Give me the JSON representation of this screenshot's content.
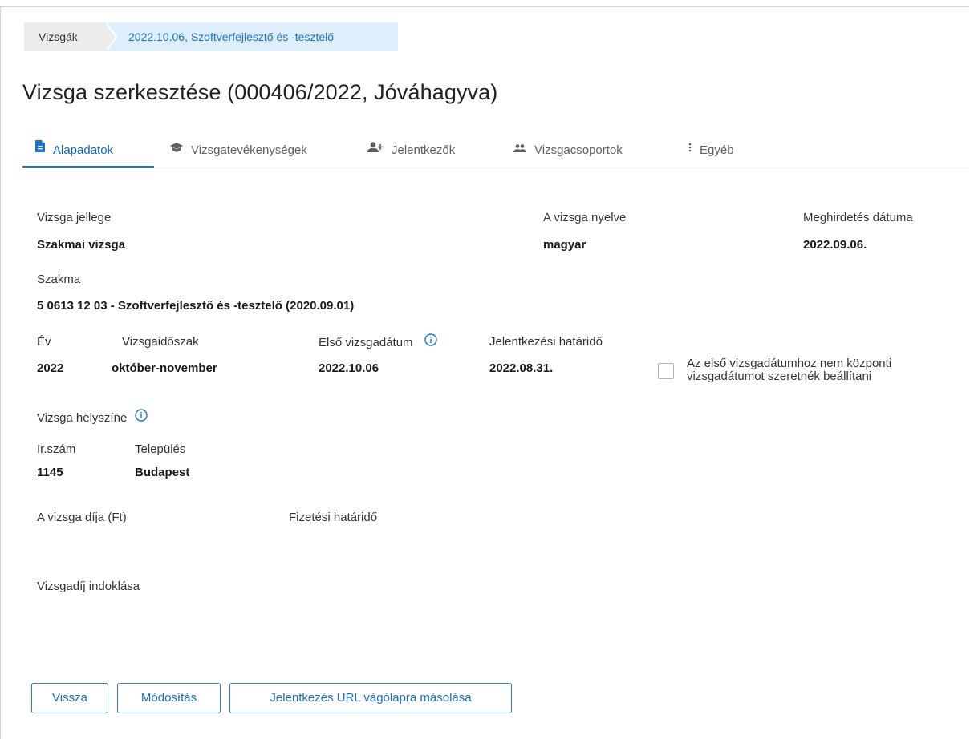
{
  "breadcrumb": {
    "items": [
      "Vizsgák",
      "2022.10.06, Szoftverfejlesztő és -tesztelő"
    ]
  },
  "page": {
    "title": "Vizsga szerkesztése (000406/2022, Jóváhagyva)"
  },
  "tabs": [
    {
      "label": "Alapadatok",
      "icon": "document-icon",
      "active": true
    },
    {
      "label": "Vizsgatevékenységek",
      "icon": "graduation-cap-icon",
      "active": false
    },
    {
      "label": "Jelentkezők",
      "icon": "person-add-icon",
      "active": false
    },
    {
      "label": "Vizsgacsoportok",
      "icon": "group-icon",
      "active": false
    },
    {
      "label": "Egyéb",
      "icon": "more-vert-icon",
      "active": false
    }
  ],
  "fields": {
    "exam_type": {
      "label": "Vizsga jellege",
      "value": "Szakmai vizsga"
    },
    "language": {
      "label": "A vizsga nyelve",
      "value": "magyar"
    },
    "announce_date": {
      "label": "Meghirdetés dátuma",
      "value": "2022.09.06."
    },
    "profession": {
      "label": "Szakma",
      "value": "5 0613 12 03 - Szoftverfejlesztő és -tesztelő (2020.09.01)"
    },
    "year": {
      "label": "Év",
      "value": "2022"
    },
    "period": {
      "label": "Vizsgaidőszak",
      "value": "október-november"
    },
    "first_date": {
      "label": "Első vizsgadátum",
      "value": "2022.10.06"
    },
    "deadline": {
      "label": "Jelentkezési határidő",
      "value": "2022.08.31."
    },
    "location": {
      "label": "Vizsga helyszíne"
    },
    "zip": {
      "label": "Ir.szám",
      "value": "1145"
    },
    "city": {
      "label": "Település",
      "value": "Budapest"
    },
    "fee": {
      "label": "A vizsga díja (Ft)",
      "value": ""
    },
    "payment_deadline": {
      "label": "Fizetési határidő",
      "value": ""
    },
    "fee_reason": {
      "label": "Vizsgadíj indoklása",
      "value": ""
    }
  },
  "checkbox": {
    "label": "Az első vizsgadátumhoz nem központi vizsgadátumot szeretnék beállítani",
    "checked": false
  },
  "buttons": {
    "back": "Vissza",
    "modify": "Módosítás",
    "copy_url": "Jelentkezés URL vágólapra másolása"
  },
  "colors": {
    "accent": "#1a73c8",
    "breadcrumb_active_bg": "#dfeefb",
    "breadcrumb_bg": "#ececec"
  }
}
